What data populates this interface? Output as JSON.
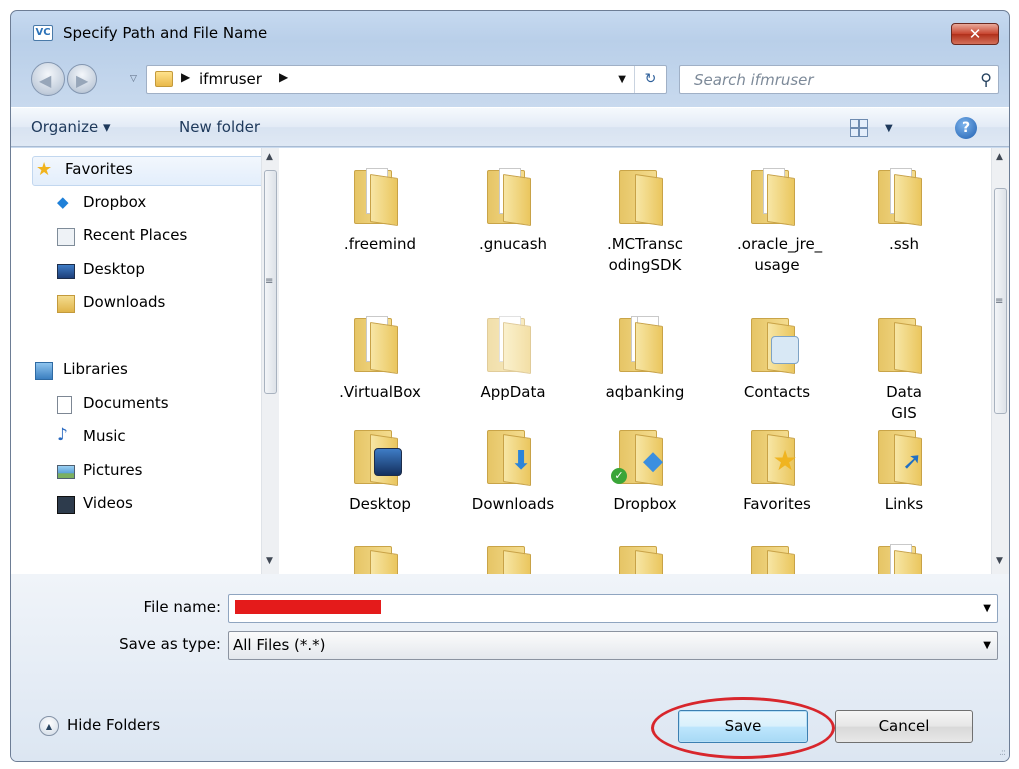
{
  "window": {
    "title": "Specify Path and File Name",
    "app_icon_text": "VC",
    "close_label": "✕"
  },
  "address_bar": {
    "current_folder": "ifmruser",
    "search_placeholder": "Search ifmruser"
  },
  "toolbar": {
    "organize_label": "Organize ▾",
    "new_folder_label": "New folder",
    "help_label": "?"
  },
  "sidebar": {
    "items": [
      {
        "label": "Favorites",
        "icon": "star-icon",
        "group": true
      },
      {
        "label": "Dropbox",
        "icon": "dropbox-icon"
      },
      {
        "label": "Recent Places",
        "icon": "recent-places-icon"
      },
      {
        "label": "Desktop",
        "icon": "desktop-icon"
      },
      {
        "label": "Downloads",
        "icon": "downloads-icon"
      },
      {
        "label": "Libraries",
        "icon": "libraries-icon",
        "group": true
      },
      {
        "label": "Documents",
        "icon": "document-icon"
      },
      {
        "label": "Music",
        "icon": "music-icon"
      },
      {
        "label": "Pictures",
        "icon": "pictures-icon"
      },
      {
        "label": "Videos",
        "icon": "videos-icon"
      }
    ]
  },
  "files": [
    {
      "label": ".freemind"
    },
    {
      "label": ".gnucash"
    },
    {
      "label": ".MCTransc odingSDK"
    },
    {
      "label": ".oracle_jre_ usage"
    },
    {
      "label": ".ssh"
    },
    {
      "label": ".VirtualBox"
    },
    {
      "label": "AppData"
    },
    {
      "label": "aqbanking"
    },
    {
      "label": "Contacts"
    },
    {
      "label": "Data GIS"
    },
    {
      "label": "Desktop"
    },
    {
      "label": "Downloads"
    },
    {
      "label": "Dropbox"
    },
    {
      "label": "Favorites"
    },
    {
      "label": "Links"
    }
  ],
  "form": {
    "file_name_label": "File name:",
    "file_name_value": "",
    "save_type_label": "Save as type:",
    "save_type_value": "All Files (*.*)"
  },
  "footer": {
    "hide_folders_label": "Hide Folders",
    "save_label": "Save",
    "cancel_label": "Cancel"
  },
  "colors": {
    "highlight_ellipse": "#d8262c",
    "redaction": "#e41b1b"
  }
}
